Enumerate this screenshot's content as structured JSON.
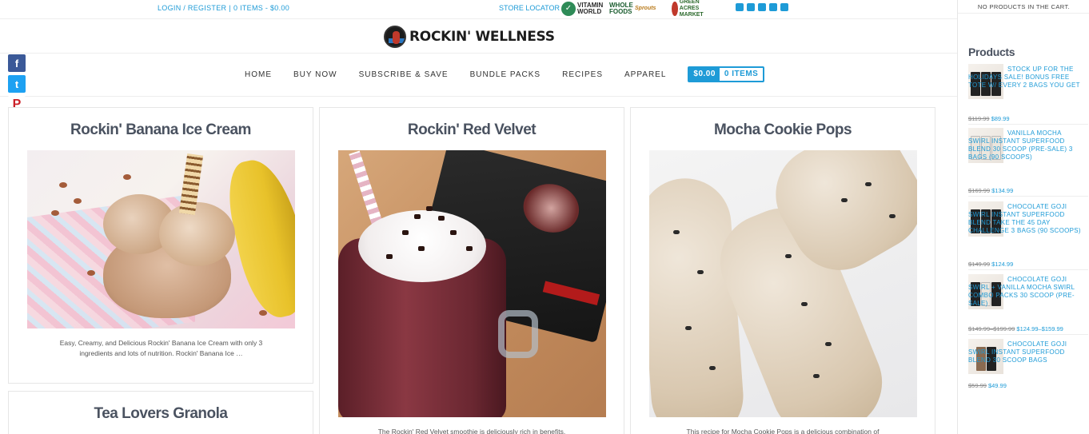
{
  "topbar": {
    "login": "LOGIN / REGISTER",
    "cart_summary": "0 ITEMS - $0.00",
    "store_locator": "STORE LOCATOR",
    "retailers": [
      "VITAMIN WORLD",
      "WHOLE FOODS",
      "Sprouts",
      "GREEN ACRES MARKET"
    ],
    "social": [
      "facebook-icon",
      "twitter-icon",
      "instagram-icon",
      "pinterest-icon",
      "tumblr-icon"
    ]
  },
  "brand": {
    "name": "ROCKIN' WELLNESS"
  },
  "nav": {
    "items": [
      "HOME",
      "BUY NOW",
      "SUBSCRIBE & SAVE",
      "BUNDLE PACKS",
      "RECIPES",
      "APPAREL"
    ],
    "cart_amount": "$0.00",
    "cart_items": "0 ITEMS"
  },
  "share": [
    "facebook-share-icon",
    "twitter-share-icon",
    "pinterest-share-icon",
    "gmail-share-icon",
    "addthis-share-icon"
  ],
  "recipes": [
    {
      "title": "Rockin' Banana Ice Cream",
      "excerpt": "Easy, Creamy, and Delicious Rockin' Banana Ice Cream with only 3 ingredients and lots of nutrition. Rockin' Banana Ice …"
    },
    {
      "title": "Rockin' Red Velvet",
      "excerpt": "The Rockin' Red Velvet smoothie is deliciously rich in benefits."
    },
    {
      "title": "Mocha Cookie Pops",
      "excerpt": "This recipe for Mocha Cookie Pops is a delicious combination of"
    },
    {
      "title": "Tea Lovers Granola",
      "excerpt": ""
    }
  ],
  "sidebar": {
    "cart_empty": "NO PRODUCTS IN THE CART.",
    "products_title": "Products",
    "products": [
      {
        "title": "STOCK UP FOR THE HOLIDAYS SALE! BONUS FREE TOTE W/ EVERY 2 BAGS YOU GET",
        "old_price": "$119.99",
        "price": "$89.99"
      },
      {
        "title": "VANILLA MOCHA SWIRL INSTANT SUPERFOOD BLEND 30 SCOOP (PRE-SALE) 3 BAGS (90 SCOOPS)",
        "old_price": "$169.99",
        "price": "$134.99"
      },
      {
        "title": "CHOCOLATE GOJI SWIRL INSTANT SUPERFOOD BLEND TAKE THE 45 DAY CHALLENGE 3 BAGS (90 SCOOPS)",
        "old_price": "$149.99",
        "price": "$124.99"
      },
      {
        "title": "CHOCOLATE GOJI SWIRL + VANILLA MOCHA SWIRL COMBO PACKS 30 SCOOP (PRE-SALE)",
        "old_price": "$149.99–$199.99",
        "price": "$124.99–$159.99"
      },
      {
        "title": "CHOCOLATE GOJI SWIRL INSTANT SUPERFOOD BLEND 30 SCOOP BAGS",
        "old_price": "$59.99",
        "price": "$49.99"
      }
    ]
  }
}
